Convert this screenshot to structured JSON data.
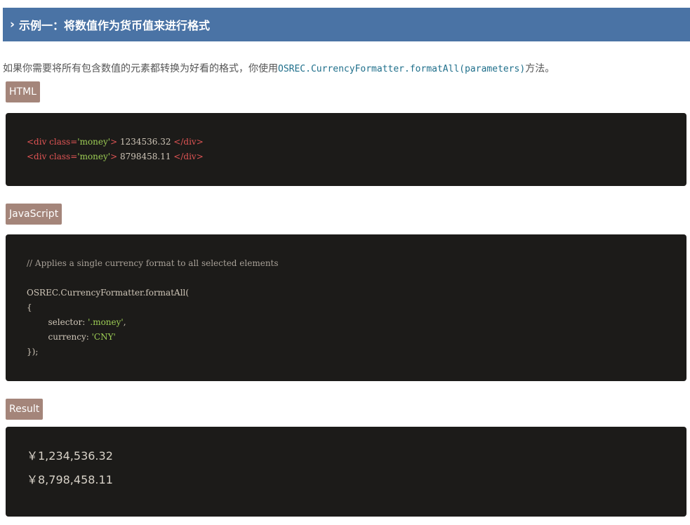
{
  "header": {
    "chevron": "›",
    "title": "示例一：将数值作为货币值来进行格式"
  },
  "intro": {
    "text_before": "如果你需要将所有包含数值的元素都转换为好看的格式，你使用",
    "code": "OSREC.CurrencyFormatter.formatAll(parameters)",
    "text_after": "方法。"
  },
  "html_section": {
    "label": "HTML",
    "lines": [
      {
        "open": "<div class=",
        "cls": "'money'",
        "close1": ">",
        "value": " 1234536.32 ",
        "end": "</div>"
      },
      {
        "open": "<div class=",
        "cls": "'money'",
        "close1": ">",
        "value": " 8798458.11 ",
        "end": "</div>"
      }
    ]
  },
  "js_section": {
    "label": "JavaScript",
    "comment": "// Applies a single currency format to all selected elements",
    "call": "OSREC.CurrencyFormatter.formatAll(",
    "brace_open": "{",
    "selector_key": "        selector: ",
    "selector_val": "'.money'",
    "selector_comma": ",",
    "currency_key": "        currency: ",
    "currency_val": "'CNY'",
    "close": "});"
  },
  "result_section": {
    "label": "Result",
    "values": [
      "￥1,234,536.32",
      "￥8,798,458.11"
    ]
  },
  "colors": {
    "header_bg": "#4a73a5",
    "tag_bg": "#a4857a",
    "code_bg": "#1c1b19",
    "code_tag": "#e05454",
    "code_string": "#9ccc54",
    "intro_code": "#1f6f8b"
  }
}
